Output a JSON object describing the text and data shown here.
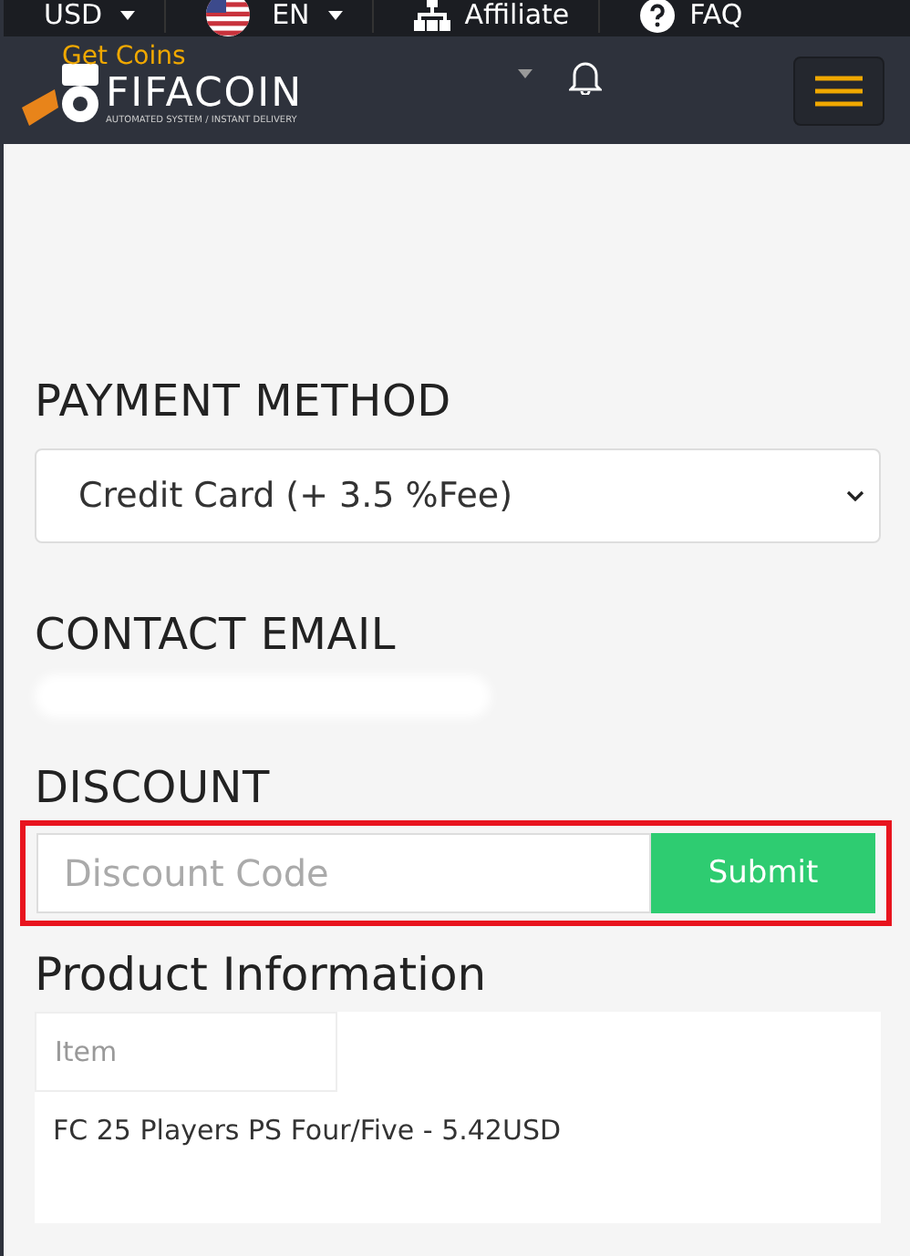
{
  "top_bar": {
    "currency": "USD",
    "language": "EN",
    "affiliate": "Affiliate",
    "faq": "FAQ"
  },
  "nav": {
    "get_coins": "Get Coins",
    "logo_name": "FIFACOIN",
    "logo_tagline": "AUTOMATED SYSTEM / INSTANT DELIVERY"
  },
  "payment": {
    "heading": "PAYMENT METHOD",
    "value": "Credit Card (+ 3.5 %Fee)"
  },
  "contact": {
    "heading": "CONTACT EMAIL"
  },
  "discount": {
    "heading": "DISCOUNT",
    "placeholder": "Discount Code",
    "button": "Submit"
  },
  "product": {
    "heading": "Product Information",
    "column_header": "Item",
    "rows": [
      "FC 25 Players PS Four/Five - 5.42USD"
    ]
  }
}
